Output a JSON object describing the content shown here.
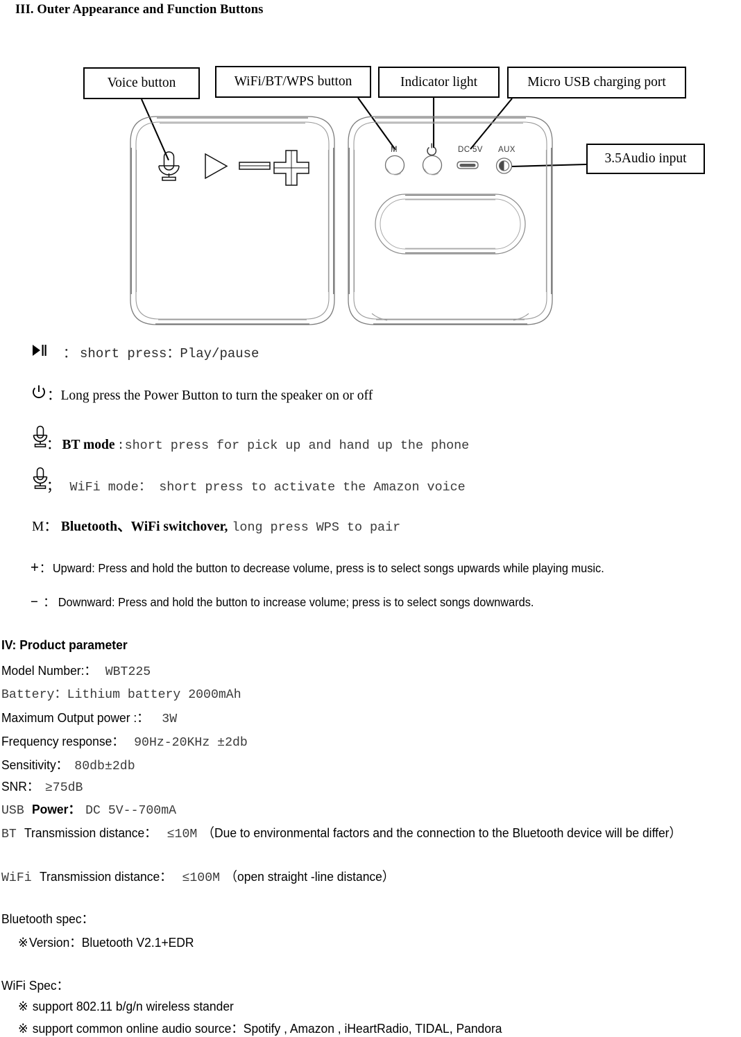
{
  "document": {
    "section_heading": "III. Outer Appearance and Function Buttons"
  },
  "diagram": {
    "callouts": [
      {
        "id": "voice-button",
        "label": "Voice button"
      },
      {
        "id": "wifi-bt-wps",
        "label": "WiFi/BT/WPS button"
      },
      {
        "id": "indicator-light",
        "label": "Indicator light"
      },
      {
        "id": "micro-usb",
        "label": "Micro USB charging port"
      },
      {
        "id": "audio-input",
        "label": "3.5Audio input"
      }
    ],
    "device_port_labels": {
      "mode": "M",
      "power": "⏻",
      "dc": "DC 5V",
      "aux": "AUX"
    },
    "front_icons": [
      "mic-icon",
      "play-icon",
      "minus-icon",
      "plus-icon"
    ]
  },
  "functions": [
    {
      "icon": "play-pause-icon",
      "sep": "：",
      "text": "short press：Play/pause"
    },
    {
      "icon": "power-icon",
      "sep": "：",
      "text": "Long press the Power Button to turn the speaker on or off"
    },
    {
      "icon": "mic-icon",
      "sep": "：",
      "bold_text": "BT mode",
      "text": ":short press for pick up and hand up the phone"
    },
    {
      "icon": "mic-icon",
      "sep": "；",
      "text": "WiFi mode： short press to activate the Amazon voice"
    },
    {
      "icon": "M",
      "sep": "：",
      "bold_text": "Bluetooth、WiFi switchover,",
      "text": "long press WPS to pair"
    },
    {
      "icon": "+",
      "sep": "：",
      "text": "Upward: Press and hold the button to decrease volume, press is to select songs upwards while playing music."
    },
    {
      "icon": "−",
      "sep": "：",
      "text": "Downward: Press and hold the button to increase volume; press is to select songs downwards."
    }
  ],
  "product": {
    "heading": "IV: Product parameter",
    "rows": [
      {
        "label": "Model Number:：",
        "value": "WBT225"
      },
      {
        "label": "Battery：",
        "value": "Lithium battery 2000mAh",
        "label_mono": true
      },
      {
        "label": "Maximum Output power :：",
        "value": "3W"
      },
      {
        "label": "Frequency response：",
        "value": "90Hz-20KHz ±2db"
      },
      {
        "label": "Sensitivity：",
        "value": "80db±2db"
      },
      {
        "label": "SNR：",
        "value": "≥75dB"
      }
    ],
    "usb_power": {
      "prefix_mono": "USB ",
      "label": "Power：",
      "value": "DC 5V--700mA"
    },
    "bt_distance": {
      "prefix_mono": "BT ",
      "label": "Transmission distance：",
      "value": "≤10M",
      "note": "（Due to environmental factors and the connection to the Bluetooth device will be differ）"
    },
    "wifi_distance": {
      "prefix_mono": "WiFi ",
      "label": "Transmission distance：",
      "value": "≤100M",
      "note": "（open straight -line distance）"
    }
  },
  "bluetooth_spec": {
    "heading": "Bluetooth spec：",
    "items": [
      {
        "bullet": "※",
        "text": "Version：Bluetooth V2.1+EDR"
      }
    ]
  },
  "wifi_spec": {
    "heading": "WiFi Spec：",
    "items": [
      {
        "bullet": "※",
        "text": "support 802.11 b/g/n wireless stander"
      },
      {
        "bullet": "※",
        "text": "support common online audio source：Spotify , Amazon , iHeartRadio, TIDAL, Pandora"
      }
    ]
  }
}
